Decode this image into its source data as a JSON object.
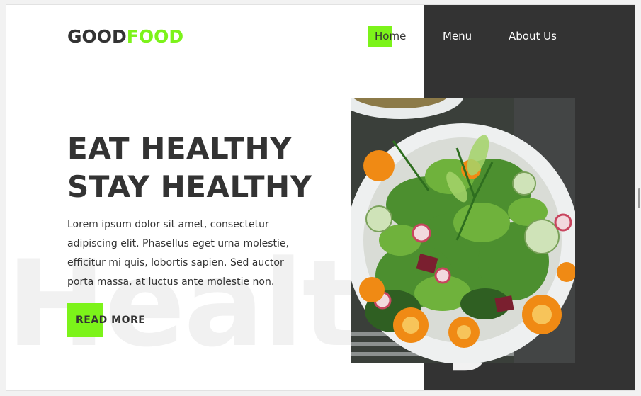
{
  "brand": {
    "part1": "GOOD",
    "part2": "FOOD",
    "accent": "#7cf31a",
    "dark": "#333333"
  },
  "nav": {
    "home": "Home",
    "menu": "Menu",
    "about": "About Us"
  },
  "hero": {
    "line1": "EAT HEALTHY",
    "line2": "STAY HEALTHY",
    "body": "Lorem ipsum dolor sit amet, consectetur adipiscing elit. Phasellus eget urna molestie, efficitur mi quis, lobortis sapien. Sed auctor porta massa, at luctus ante molestie non.",
    "cta": "READ MORE",
    "watermark": "Healthy"
  },
  "image": {
    "alt": "Salad plate with greens, tomatoes, radishes and cucumber"
  }
}
